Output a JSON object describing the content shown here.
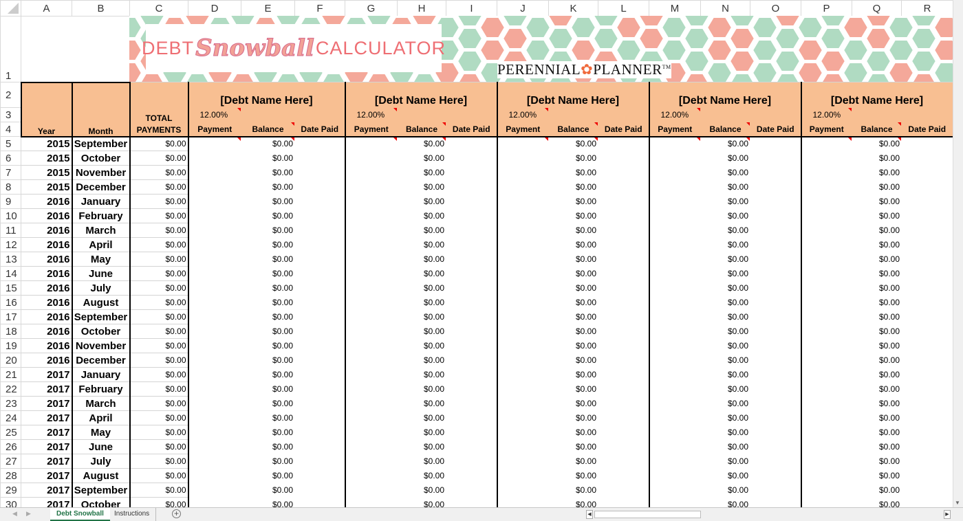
{
  "columns": [
    "A",
    "B",
    "C",
    "D",
    "E",
    "F",
    "G",
    "H",
    "I",
    "J",
    "K",
    "L",
    "M",
    "N",
    "O",
    "P",
    "Q",
    "R"
  ],
  "banner": {
    "debt": "DEBT",
    "snowball": "Snowball",
    "calculator": "CALCULATOR",
    "brand_left": "PERENNIAL",
    "brand_right": "PLANNER",
    "brand_tm": "TM",
    "colors": {
      "salmon": "#F4A89A",
      "green": "#B0DBC2"
    }
  },
  "header": {
    "year": "Year",
    "month": "Month",
    "total_line1": "TOTAL",
    "total_line2": "PAYMENTS",
    "header_fill": "#F8BF92"
  },
  "debts": [
    {
      "name": "[Debt Name Here]",
      "rate": "12.00%",
      "payment": "Payment",
      "balance": "Balance",
      "date_paid": "Date Paid"
    },
    {
      "name": "[Debt Name Here]",
      "rate": "12.00%",
      "payment": "Payment",
      "balance": "Balance",
      "date_paid": "Date Paid"
    },
    {
      "name": "[Debt Name Here]",
      "rate": "12.00%",
      "payment": "Payment",
      "balance": "Balance",
      "date_paid": "Date Paid"
    },
    {
      "name": "[Debt Name Here]",
      "rate": "12.00%",
      "payment": "Payment",
      "balance": "Balance",
      "date_paid": "Date Paid"
    },
    {
      "name": "[Debt Name Here]",
      "rate": "12.00%",
      "payment": "Payment",
      "balance": "Balance",
      "date_paid": "Date Paid"
    }
  ],
  "rows": [
    {
      "n": "5",
      "year": "2015",
      "month": "September",
      "total": "$0.00",
      "balances": [
        "$0.00",
        "$0.00",
        "$0.00",
        "$0.00",
        "$0.00"
      ]
    },
    {
      "n": "6",
      "year": "2015",
      "month": "October",
      "total": "$0.00",
      "balances": [
        "$0.00",
        "$0.00",
        "$0.00",
        "$0.00",
        "$0.00"
      ]
    },
    {
      "n": "7",
      "year": "2015",
      "month": "November",
      "total": "$0.00",
      "balances": [
        "$0.00",
        "$0.00",
        "$0.00",
        "$0.00",
        "$0.00"
      ]
    },
    {
      "n": "8",
      "year": "2015",
      "month": "December",
      "total": "$0.00",
      "balances": [
        "$0.00",
        "$0.00",
        "$0.00",
        "$0.00",
        "$0.00"
      ]
    },
    {
      "n": "9",
      "year": "2016",
      "month": "January",
      "total": "$0.00",
      "balances": [
        "$0.00",
        "$0.00",
        "$0.00",
        "$0.00",
        "$0.00"
      ]
    },
    {
      "n": "10",
      "year": "2016",
      "month": "February",
      "total": "$0.00",
      "balances": [
        "$0.00",
        "$0.00",
        "$0.00",
        "$0.00",
        "$0.00"
      ]
    },
    {
      "n": "11",
      "year": "2016",
      "month": "March",
      "total": "$0.00",
      "balances": [
        "$0.00",
        "$0.00",
        "$0.00",
        "$0.00",
        "$0.00"
      ]
    },
    {
      "n": "12",
      "year": "2016",
      "month": "April",
      "total": "$0.00",
      "balances": [
        "$0.00",
        "$0.00",
        "$0.00",
        "$0.00",
        "$0.00"
      ]
    },
    {
      "n": "13",
      "year": "2016",
      "month": "May",
      "total": "$0.00",
      "balances": [
        "$0.00",
        "$0.00",
        "$0.00",
        "$0.00",
        "$0.00"
      ]
    },
    {
      "n": "14",
      "year": "2016",
      "month": "June",
      "total": "$0.00",
      "balances": [
        "$0.00",
        "$0.00",
        "$0.00",
        "$0.00",
        "$0.00"
      ]
    },
    {
      "n": "15",
      "year": "2016",
      "month": "July",
      "total": "$0.00",
      "balances": [
        "$0.00",
        "$0.00",
        "$0.00",
        "$0.00",
        "$0.00"
      ]
    },
    {
      "n": "16",
      "year": "2016",
      "month": "August",
      "total": "$0.00",
      "balances": [
        "$0.00",
        "$0.00",
        "$0.00",
        "$0.00",
        "$0.00"
      ]
    },
    {
      "n": "17",
      "year": "2016",
      "month": "September",
      "total": "$0.00",
      "balances": [
        "$0.00",
        "$0.00",
        "$0.00",
        "$0.00",
        "$0.00"
      ]
    },
    {
      "n": "18",
      "year": "2016",
      "month": "October",
      "total": "$0.00",
      "balances": [
        "$0.00",
        "$0.00",
        "$0.00",
        "$0.00",
        "$0.00"
      ]
    },
    {
      "n": "19",
      "year": "2016",
      "month": "November",
      "total": "$0.00",
      "balances": [
        "$0.00",
        "$0.00",
        "$0.00",
        "$0.00",
        "$0.00"
      ]
    },
    {
      "n": "20",
      "year": "2016",
      "month": "December",
      "total": "$0.00",
      "balances": [
        "$0.00",
        "$0.00",
        "$0.00",
        "$0.00",
        "$0.00"
      ]
    },
    {
      "n": "21",
      "year": "2017",
      "month": "January",
      "total": "$0.00",
      "balances": [
        "$0.00",
        "$0.00",
        "$0.00",
        "$0.00",
        "$0.00"
      ]
    },
    {
      "n": "22",
      "year": "2017",
      "month": "February",
      "total": "$0.00",
      "balances": [
        "$0.00",
        "$0.00",
        "$0.00",
        "$0.00",
        "$0.00"
      ]
    },
    {
      "n": "23",
      "year": "2017",
      "month": "March",
      "total": "$0.00",
      "balances": [
        "$0.00",
        "$0.00",
        "$0.00",
        "$0.00",
        "$0.00"
      ]
    },
    {
      "n": "24",
      "year": "2017",
      "month": "April",
      "total": "$0.00",
      "balances": [
        "$0.00",
        "$0.00",
        "$0.00",
        "$0.00",
        "$0.00"
      ]
    },
    {
      "n": "25",
      "year": "2017",
      "month": "May",
      "total": "$0.00",
      "balances": [
        "$0.00",
        "$0.00",
        "$0.00",
        "$0.00",
        "$0.00"
      ]
    },
    {
      "n": "26",
      "year": "2017",
      "month": "June",
      "total": "$0.00",
      "balances": [
        "$0.00",
        "$0.00",
        "$0.00",
        "$0.00",
        "$0.00"
      ]
    },
    {
      "n": "27",
      "year": "2017",
      "month": "July",
      "total": "$0.00",
      "balances": [
        "$0.00",
        "$0.00",
        "$0.00",
        "$0.00",
        "$0.00"
      ]
    },
    {
      "n": "28",
      "year": "2017",
      "month": "August",
      "total": "$0.00",
      "balances": [
        "$0.00",
        "$0.00",
        "$0.00",
        "$0.00",
        "$0.00"
      ]
    },
    {
      "n": "29",
      "year": "2017",
      "month": "September",
      "total": "$0.00",
      "balances": [
        "$0.00",
        "$0.00",
        "$0.00",
        "$0.00",
        "$0.00"
      ]
    },
    {
      "n": "30",
      "year": "2017",
      "month": "October",
      "total": "$0.00",
      "balances": [
        "$0.00",
        "$0.00",
        "$0.00",
        "$0.00",
        "$0.00"
      ]
    }
  ],
  "sheet_tabs": [
    {
      "label": "Debt Snowball",
      "active": true
    },
    {
      "label": "Instructions",
      "active": false
    }
  ],
  "add_sheet_icon": "plus-circle-icon"
}
